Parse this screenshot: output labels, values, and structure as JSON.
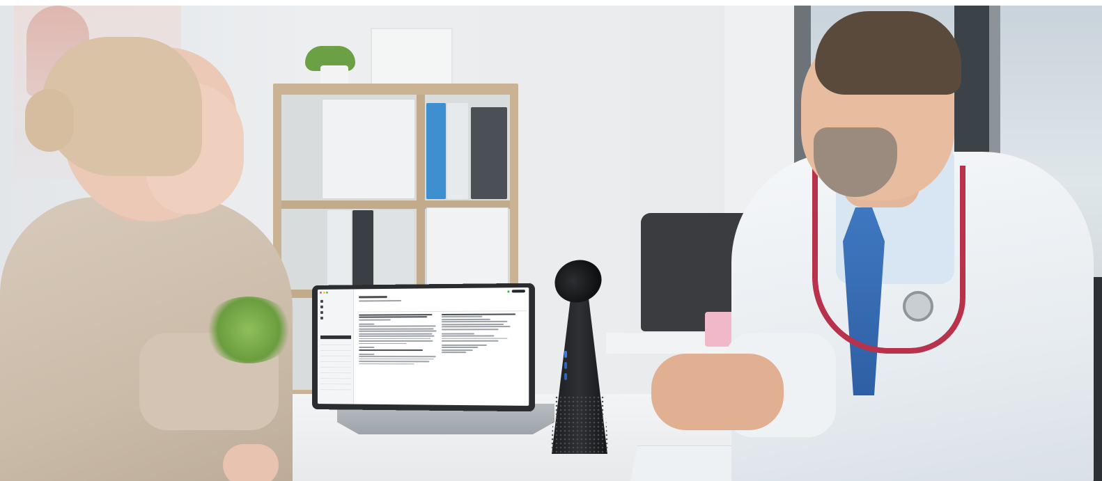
{
  "scene": {
    "description_tags": [
      "office",
      "consultation",
      "laptop",
      "speakerphone"
    ],
    "colors": {
      "wall": "#e6e8ea",
      "desk": "#f1f2f3",
      "coat": "#f3f5f7",
      "tie": "#3f78c0",
      "stethoscope": "#b8324c",
      "sweater": "#d3c4b3",
      "device": "#1c1d20",
      "shelf_wood": "#c9b393"
    }
  },
  "laptop_screen": {
    "icons": [
      "app-logo-icon",
      "nav-icon",
      "status-dot-icon"
    ]
  }
}
